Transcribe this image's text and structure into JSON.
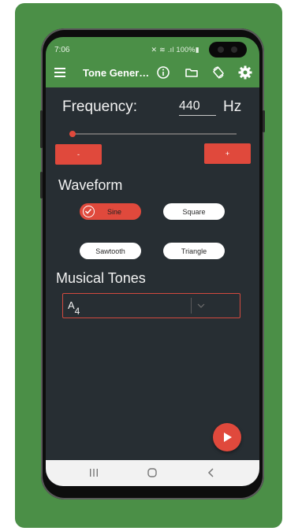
{
  "status_bar": {
    "time": "7:06",
    "indicators": "✕ ≋ .ıl 100%▮"
  },
  "app_bar": {
    "title": "Tone Gener…",
    "icons": [
      "menu-icon",
      "info-icon",
      "folder-icon",
      "rotate-icon",
      "gear-icon"
    ]
  },
  "frequency": {
    "label": "Frequency:",
    "value": "440",
    "unit": "Hz",
    "slider_fraction": 0.02,
    "decrement_label": "-",
    "increment_label": "+"
  },
  "waveform": {
    "title": "Waveform",
    "options": [
      "Sine",
      "Square",
      "Sawtooth",
      "Triangle"
    ],
    "selected": "Sine"
  },
  "musical_tones": {
    "title": "Musical Tones",
    "selected_note": "A",
    "selected_octave": "4"
  },
  "colors": {
    "accent": "#e0493c",
    "brand_green": "#4b8f47",
    "background": "#272e33"
  }
}
